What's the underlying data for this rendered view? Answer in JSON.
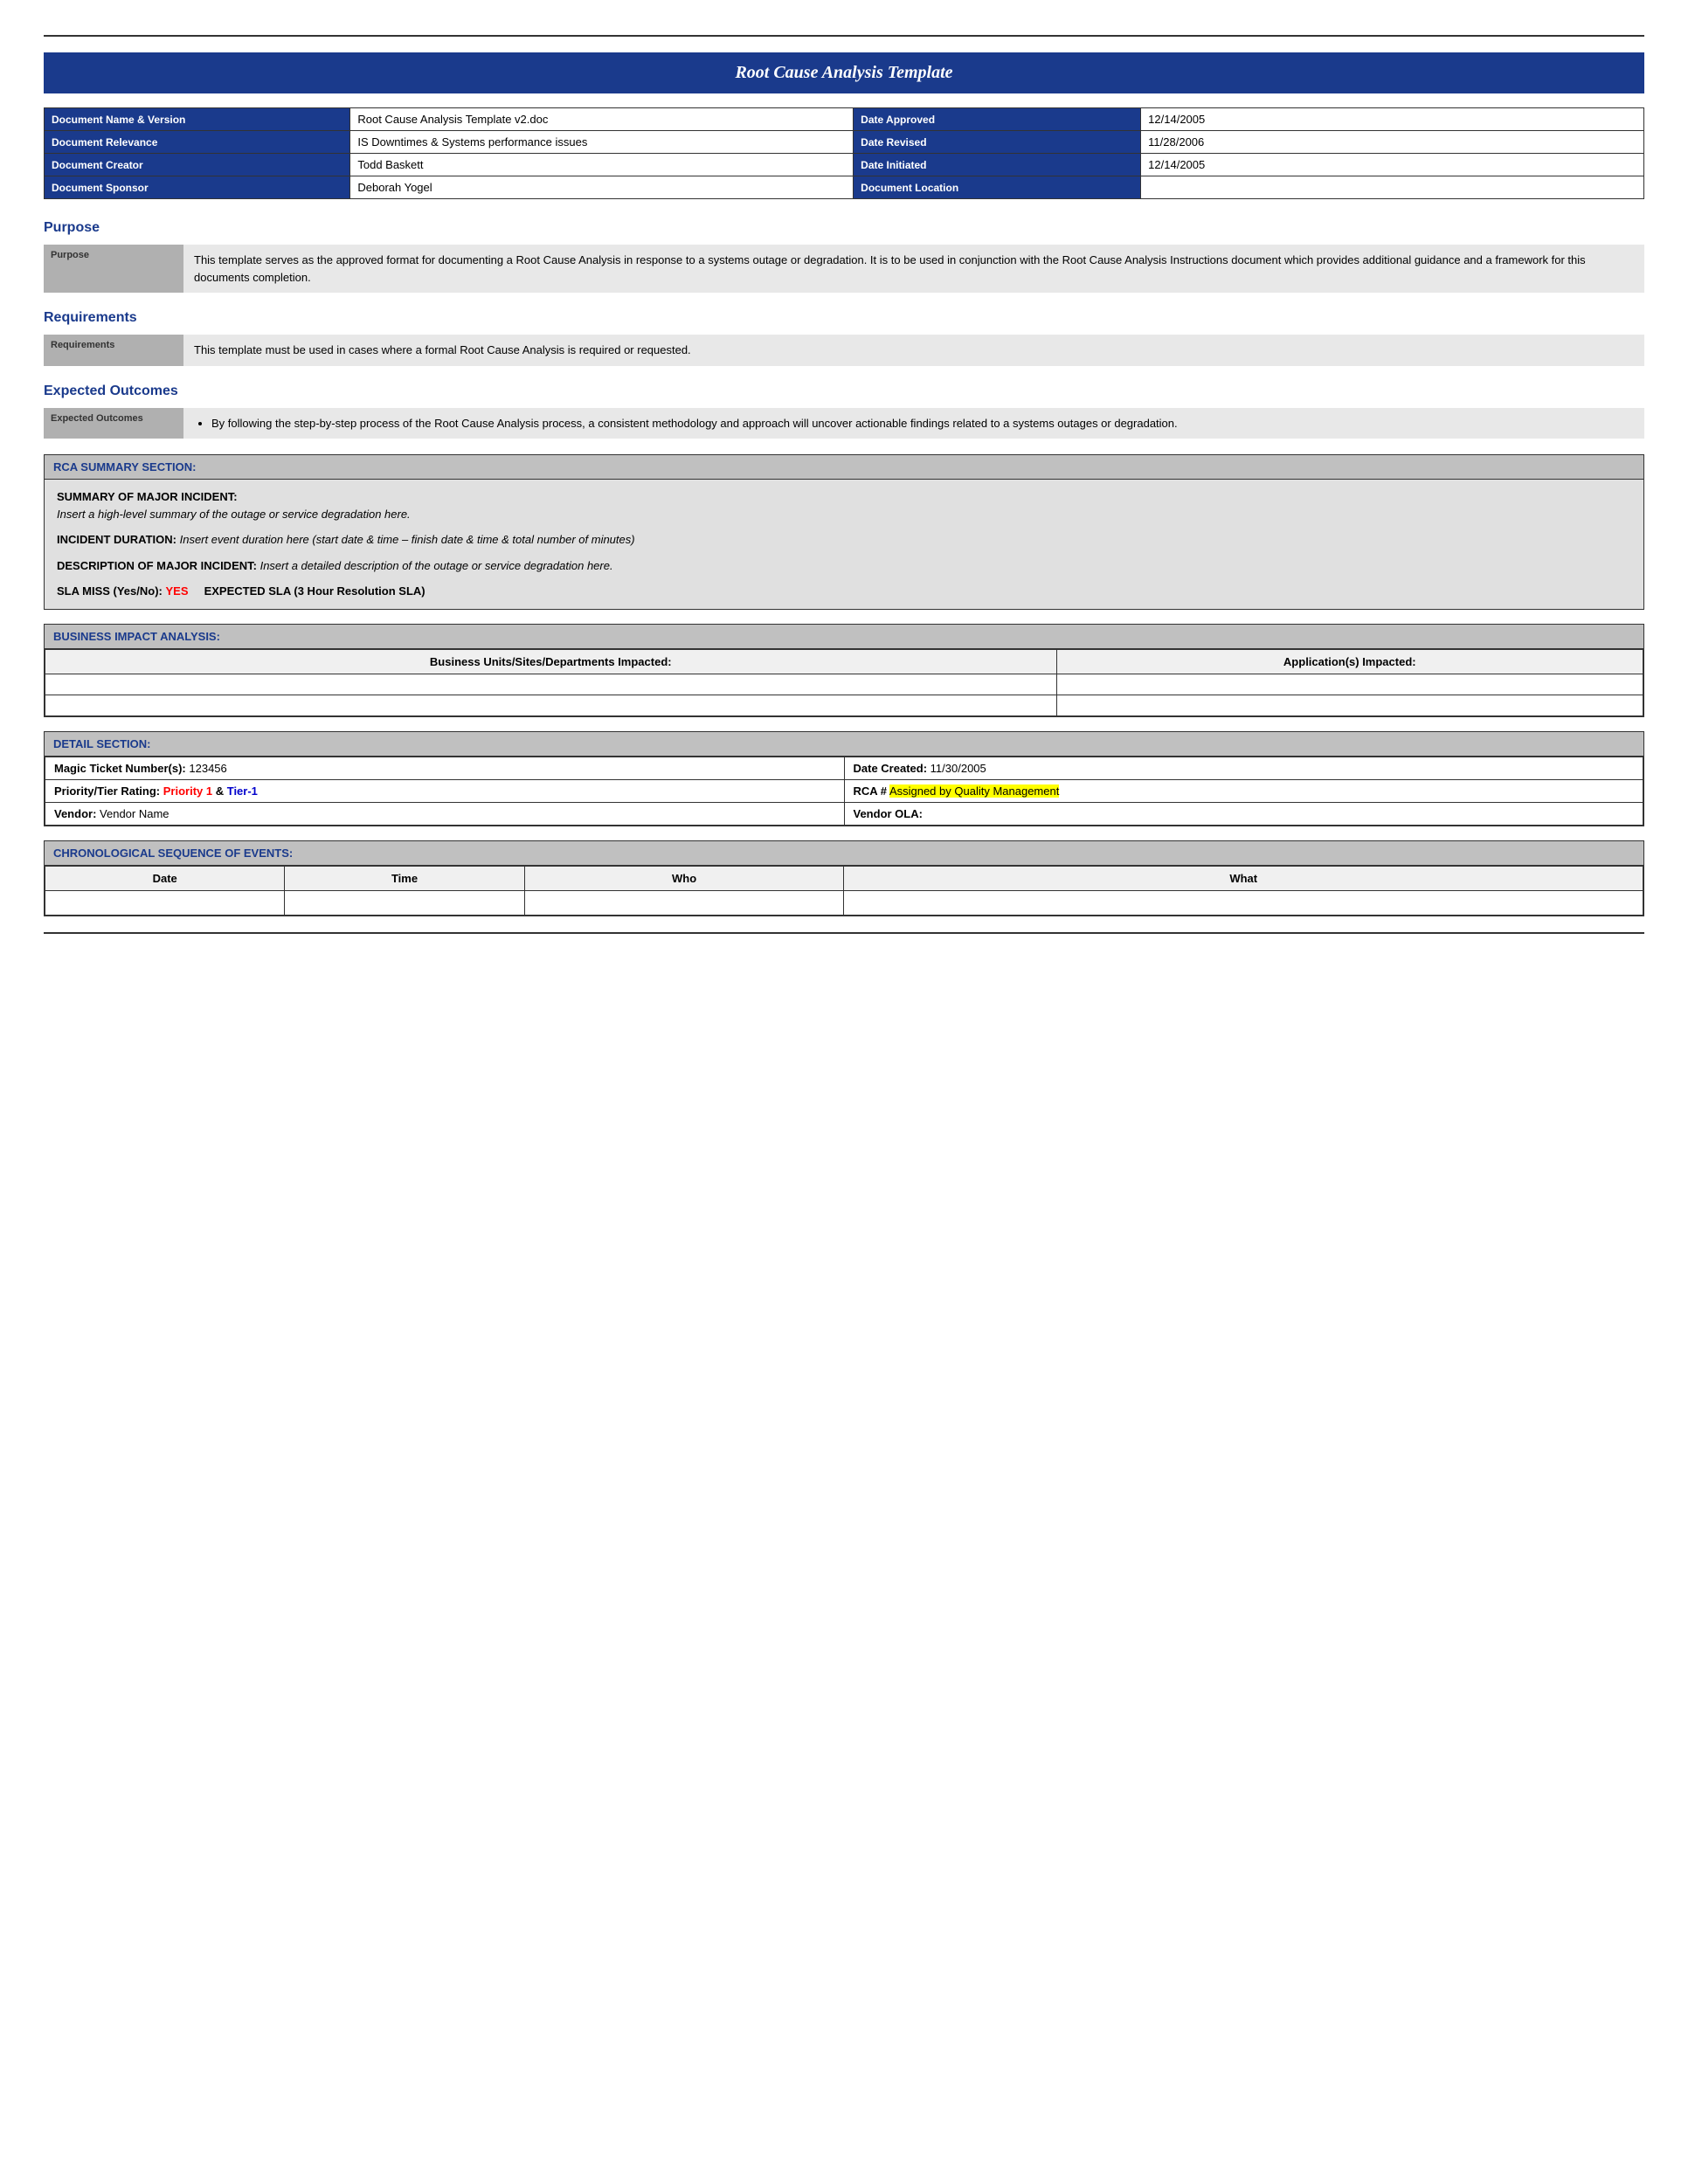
{
  "title": "Root Cause Analysis Template",
  "topRule": true,
  "infoTable": {
    "rows": [
      {
        "label1": "Document Name & Version",
        "value1": "Root Cause Analysis Template v2.doc",
        "label2": "Date Approved",
        "value2": "12/14/2005"
      },
      {
        "label1": "Document Relevance",
        "value1": "IS Downtimes & Systems performance issues",
        "label2": "Date Revised",
        "value2": "11/28/2006"
      },
      {
        "label1": "Document Creator",
        "value1": "Todd Baskett",
        "label2": "Date Initiated",
        "value2": "12/14/2005"
      },
      {
        "label1": "Document Sponsor",
        "value1": "Deborah Yogel",
        "label2": "Document Location",
        "value2": ""
      }
    ]
  },
  "sections": {
    "purpose": {
      "heading": "Purpose",
      "label": "Purpose",
      "text": "This template serves as the approved format for documenting a Root Cause Analysis in response to a systems outage or degradation. It is to be used in conjunction with the Root Cause Analysis Instructions document which provides additional guidance and a framework for this documents completion."
    },
    "requirements": {
      "heading": "Requirements",
      "label": "Requirements",
      "text": "This template must be used in cases where a formal Root Cause Analysis is required or requested."
    },
    "expectedOutcomes": {
      "heading": "Expected Outcomes",
      "label": "Expected Outcomes",
      "bullet": "By following the step-by-step process of the Root Cause Analysis process, a consistent methodology and approach will uncover actionable findings related to a systems outages or degradation."
    }
  },
  "rcaSummary": {
    "header": "RCA SUMMARY SECTION:",
    "summaryLabel": "SUMMARY OF MAJOR INCIDENT:",
    "summaryText": "Insert a high-level summary of the outage or service degradation here.",
    "durationLabel": "INCIDENT DURATION:",
    "durationText": "Insert event duration here (start date &  time – finish date & time & total number of minutes)",
    "descriptionLabel": "DESCRIPTION OF MAJOR INCIDENT:",
    "descriptionText": "Insert a detailed description of the outage or service degradation here.",
    "slaLabel": "SLA MISS (Yes/No):",
    "slaYes": "YES",
    "slaExpected": "EXPECTED SLA (3 Hour Resolution SLA)"
  },
  "businessImpact": {
    "header": "BUSINESS IMPACT ANALYSIS:",
    "col1": "Business Units/Sites/Departments Impacted:",
    "col2": "Application(s) Impacted:"
  },
  "detailSection": {
    "header": "DETAIL SECTION:",
    "row1": {
      "label1": "Magic Ticket Number(s):",
      "value1": "123456",
      "label2": "Date Created:",
      "value2": "11/30/2005"
    },
    "row2": {
      "label1": "Priority/Tier Rating:",
      "priority": "Priority 1",
      "amp": " & ",
      "tier": "Tier-1",
      "label2": "RCA #",
      "assignedText": "Assigned by Quality Management"
    },
    "row3": {
      "label1": "Vendor:",
      "value1": "Vendor Name",
      "label2": "Vendor OLA:",
      "value2": ""
    }
  },
  "chronoSection": {
    "header": "CHRONOLOGICAL SEQUENCE OF EVENTS:",
    "columns": [
      "Date",
      "Time",
      "Who",
      "What"
    ]
  }
}
